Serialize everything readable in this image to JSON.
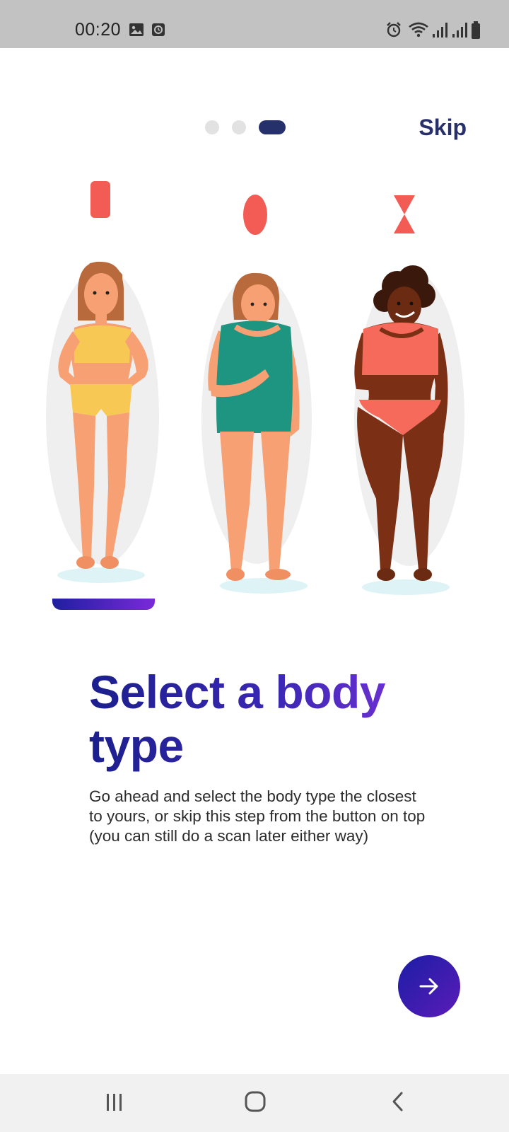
{
  "status_bar": {
    "time": "00:20",
    "left_icons": [
      "image-icon",
      "clock-app-icon"
    ],
    "right_icons": [
      "alarm-icon",
      "wifi-icon",
      "signal-icon",
      "signal-icon",
      "battery-icon"
    ]
  },
  "pager": {
    "total": 3,
    "active_index": 2
  },
  "header": {
    "skip_label": "Skip"
  },
  "body_types": [
    {
      "shape": "rectangle-icon",
      "selected": true
    },
    {
      "shape": "oval-icon",
      "selected": false
    },
    {
      "shape": "hourglass-icon",
      "selected": false
    }
  ],
  "content": {
    "title": "Select a body type",
    "description": "Go ahead and select the body type the closest to yours, or skip this step from the button on top\n(you can still do a scan later either way)"
  },
  "next_button": {
    "icon": "arrow-right-icon"
  },
  "nav_bar": {
    "icons": [
      "recent-apps-icon",
      "home-icon",
      "back-icon"
    ]
  },
  "colors": {
    "accent_start": "#1b1f8c",
    "accent_end": "#7a32db",
    "shape_coral": "#f25c54",
    "skip_navy": "#27306a"
  }
}
